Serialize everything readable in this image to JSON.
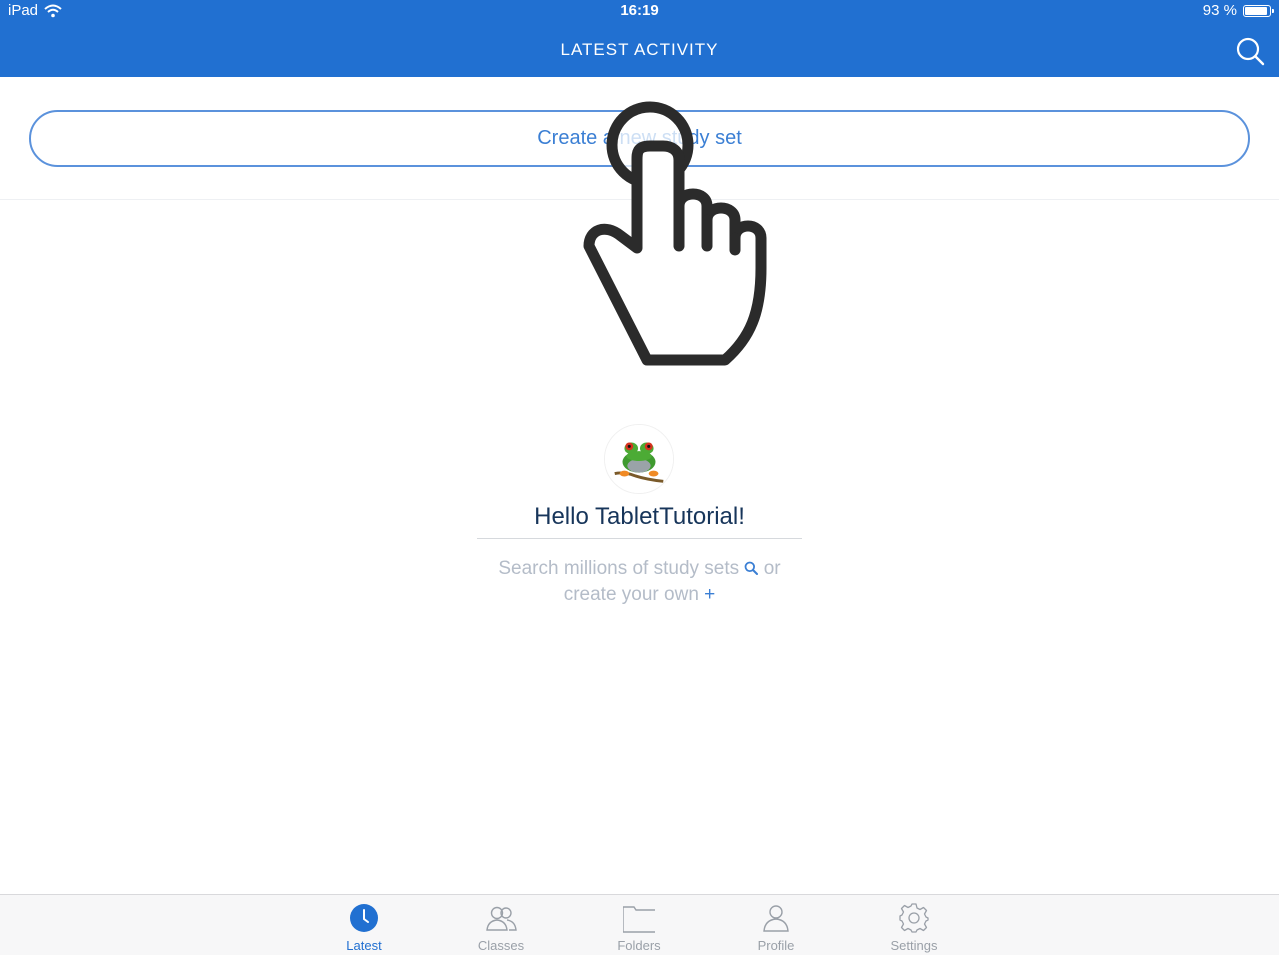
{
  "status_bar": {
    "device": "iPad",
    "time": "16:19",
    "battery": "93 %",
    "battery_level": 0.93
  },
  "header": {
    "title": "LATEST ACTIVITY",
    "search_icon": "search-icon"
  },
  "main": {
    "create_button_label": "Create a new study set",
    "greeting": "Hello TabletTutorial!",
    "hint_line1": "Search millions of study sets",
    "hint_or": "or",
    "hint_line2": "create your own",
    "hint_plus": "+"
  },
  "tabs": [
    {
      "label": "Latest",
      "icon": "clock-icon",
      "active": true
    },
    {
      "label": "Classes",
      "icon": "people-icon",
      "active": false
    },
    {
      "label": "Folders",
      "icon": "folder-icon",
      "active": false
    },
    {
      "label": "Profile",
      "icon": "person-icon",
      "active": false
    },
    {
      "label": "Settings",
      "icon": "gear-icon",
      "active": false
    }
  ],
  "colors": {
    "header_blue": "#2170d1",
    "accent_blue": "#3b7fd4",
    "greeting_text": "#17355a",
    "hint_text": "#b4bcc8"
  }
}
